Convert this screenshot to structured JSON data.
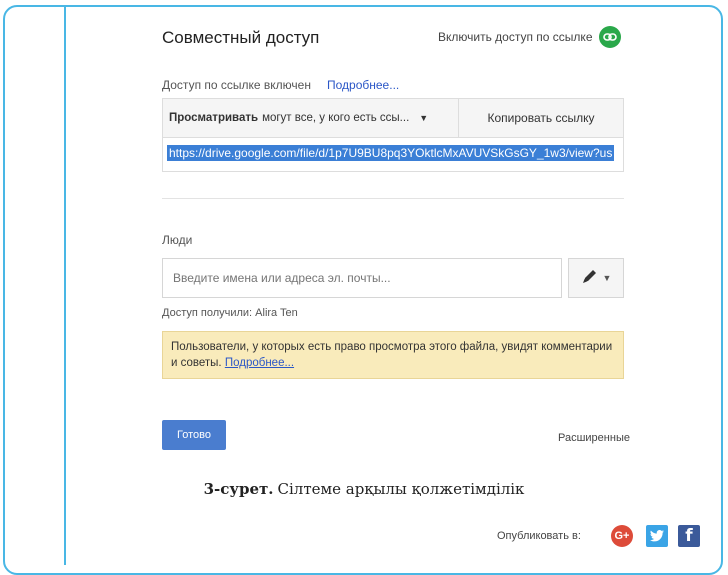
{
  "dialog": {
    "title": "Совместный доступ",
    "link_toggle_label": "Включить доступ по ссылке",
    "link_status": "Доступ по ссылке включен",
    "more_link": "Подробнее...",
    "permission_strong": "Просматривать",
    "permission_rest": "могут все, у кого есть ссы...",
    "copy_link_button": "Копировать ссылку",
    "share_url": "https://drive.google.com/file/d/1p7U9BU8pq3YOktlcMxAVUVSkGsGY_1w3/view?us",
    "people_label": "Люди",
    "email_placeholder": "Введите имена или адреса эл. почты...",
    "shared_with": "Доступ получили: Alira Ten",
    "notice_text": "Пользователи, у которых есть право просмотра этого файла, увидят комментарии и советы.",
    "notice_link": "Подробнее...",
    "done_button": "Готово",
    "advanced_link": "Расширенные"
  },
  "caption": {
    "label": "3-сурет.",
    "text": "Сілтеме арқылы қолжетімділік"
  },
  "publish": {
    "label": "Опубликовать в:",
    "gplus_text": "G+",
    "facebook_text": "f"
  },
  "colors": {
    "frame": "#49b7e5",
    "accent_blue": "#4a7dcf",
    "link_green": "#2aa84a",
    "notice_bg": "#f9ebbb",
    "gplus": "#dd4b39",
    "twitter": "#3aa4e6",
    "facebook": "#3b5a9a"
  },
  "icons": [
    "link-icon",
    "pencil-icon",
    "chevron-down-icon",
    "google-plus-icon",
    "twitter-icon",
    "facebook-icon"
  ]
}
